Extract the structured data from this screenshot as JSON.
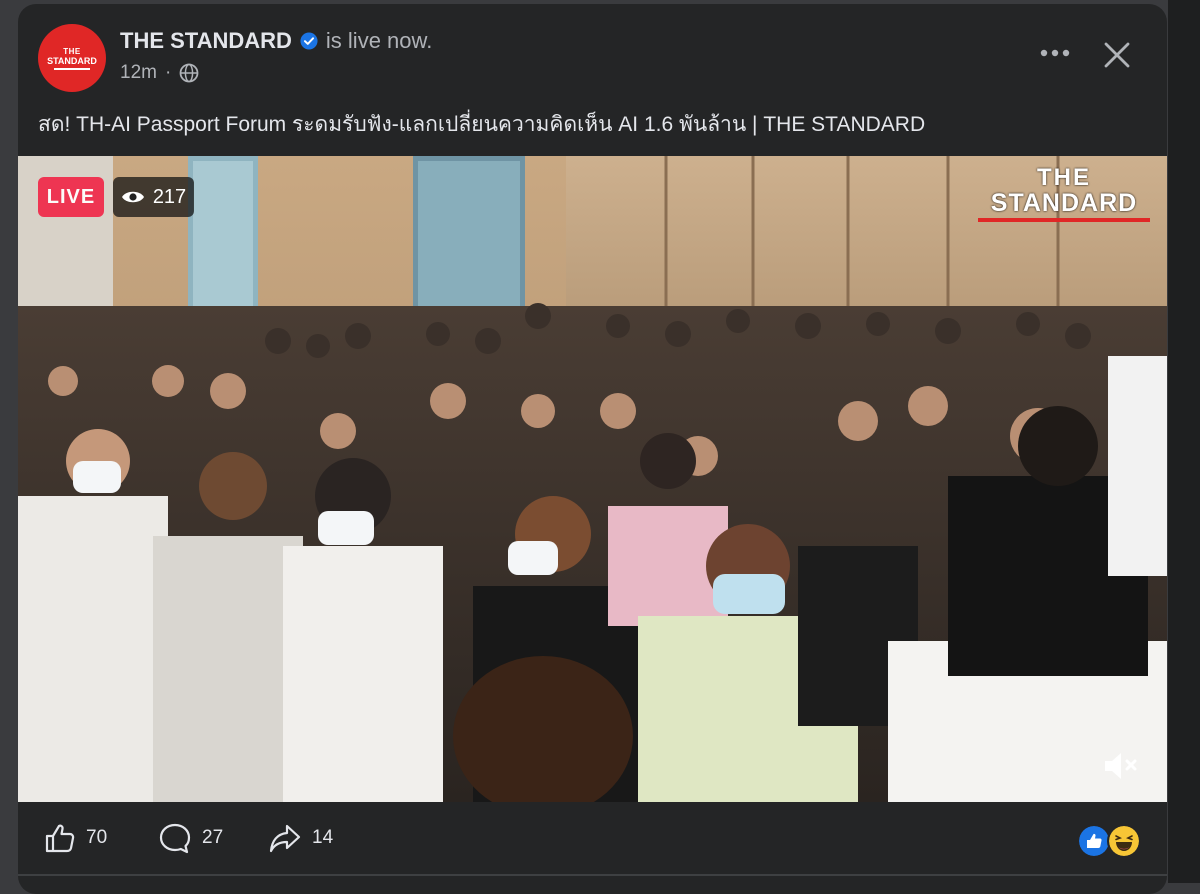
{
  "post": {
    "page_name": "THE STANDARD",
    "status_text": "is live now.",
    "time": "12m",
    "separator": "·",
    "title": "สด! TH-AI Passport Forum ระดมรับฟัง-แลกเปลี่ยนความคิดเห็น AI 1.6 พันล้าน | THE STANDARD",
    "avatar": {
      "line1": "THE",
      "line2": "STANDARD"
    }
  },
  "video": {
    "live_label": "LIVE",
    "viewer_count": "217",
    "watermark": {
      "line1": "THE",
      "line2": "STANDARD"
    },
    "colors": {
      "live": "#f02849",
      "brand": "#e02726"
    }
  },
  "footer": {
    "likes": "70",
    "comments": "27",
    "shares": "14"
  },
  "icons": [
    "verified-icon",
    "globe-icon",
    "more-icon",
    "close-icon",
    "eye-icon",
    "mute-icon",
    "like-icon",
    "comment-icon",
    "share-icon",
    "like-reaction-icon",
    "haha-reaction-icon"
  ]
}
